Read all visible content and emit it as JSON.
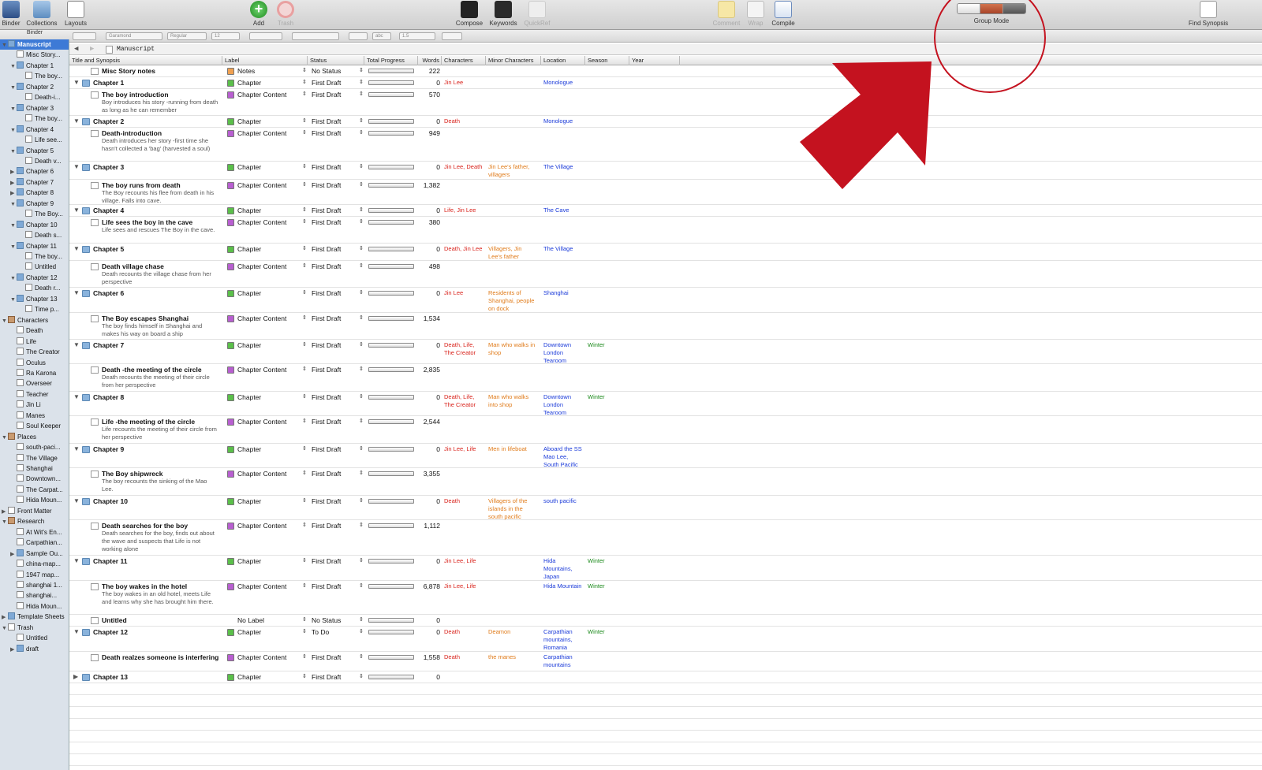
{
  "toolbar": {
    "binder": "Binder",
    "collections": "Collections",
    "layouts": "Layouts",
    "add": "Add",
    "trash": "Trash",
    "compose": "Compose",
    "keywords": "Keywords",
    "quickref": "QuickRef",
    "comment": "Comment",
    "wrap": "Wrap",
    "compile": "Compile",
    "group_mode": "Group Mode",
    "find_synopsis": "Find Synopsis"
  },
  "formatbar": {
    "font": "Garamond",
    "style": "Regular",
    "size": "12",
    "spacing": "1.5",
    "text_color": "abc"
  },
  "binder": {
    "header": "Binder",
    "items": [
      {
        "label": "Manuscript",
        "depth": 0,
        "disc": "▼",
        "icon": "folder",
        "sel": true
      },
      {
        "label": "Misc Story...",
        "depth": 1,
        "disc": "",
        "icon": "doc"
      },
      {
        "label": "Chapter 1",
        "depth": 1,
        "disc": "▼",
        "icon": "folder"
      },
      {
        "label": "The boy...",
        "depth": 2,
        "disc": "",
        "icon": "doc"
      },
      {
        "label": "Chapter 2",
        "depth": 1,
        "disc": "▼",
        "icon": "folder"
      },
      {
        "label": "Death-i...",
        "depth": 2,
        "disc": "",
        "icon": "doc"
      },
      {
        "label": "Chapter 3",
        "depth": 1,
        "disc": "▼",
        "icon": "folder"
      },
      {
        "label": "The boy...",
        "depth": 2,
        "disc": "",
        "icon": "doc"
      },
      {
        "label": "Chapter 4",
        "depth": 1,
        "disc": "▼",
        "icon": "folder"
      },
      {
        "label": "Life see...",
        "depth": 2,
        "disc": "",
        "icon": "doc"
      },
      {
        "label": "Chapter 5",
        "depth": 1,
        "disc": "▼",
        "icon": "folder"
      },
      {
        "label": "Death v...",
        "depth": 2,
        "disc": "",
        "icon": "doc"
      },
      {
        "label": "Chapter 6",
        "depth": 1,
        "disc": "▶",
        "icon": "folder"
      },
      {
        "label": "Chapter 7",
        "depth": 1,
        "disc": "▶",
        "icon": "folder"
      },
      {
        "label": "Chapter 8",
        "depth": 1,
        "disc": "▶",
        "icon": "folder"
      },
      {
        "label": "Chapter 9",
        "depth": 1,
        "disc": "▼",
        "icon": "folder"
      },
      {
        "label": "The Boy...",
        "depth": 2,
        "disc": "",
        "icon": "doc"
      },
      {
        "label": "Chapter 10",
        "depth": 1,
        "disc": "▼",
        "icon": "folder"
      },
      {
        "label": "Death s...",
        "depth": 2,
        "disc": "",
        "icon": "doc"
      },
      {
        "label": "Chapter 11",
        "depth": 1,
        "disc": "▼",
        "icon": "folder"
      },
      {
        "label": "The boy...",
        "depth": 2,
        "disc": "",
        "icon": "doc"
      },
      {
        "label": "Untitled",
        "depth": 2,
        "disc": "",
        "icon": "doc"
      },
      {
        "label": "Chapter 12",
        "depth": 1,
        "disc": "▼",
        "icon": "folder"
      },
      {
        "label": "Death r...",
        "depth": 2,
        "disc": "",
        "icon": "doc"
      },
      {
        "label": "Chapter 13",
        "depth": 1,
        "disc": "▼",
        "icon": "folder"
      },
      {
        "label": "Time p...",
        "depth": 2,
        "disc": "",
        "icon": "doc"
      },
      {
        "label": "Characters",
        "depth": 0,
        "disc": "▼",
        "icon": "group"
      },
      {
        "label": "Death",
        "depth": 1,
        "disc": "",
        "icon": "doc"
      },
      {
        "label": "Life",
        "depth": 1,
        "disc": "",
        "icon": "doc"
      },
      {
        "label": "The Creator",
        "depth": 1,
        "disc": "",
        "icon": "doc"
      },
      {
        "label": "Oculus",
        "depth": 1,
        "disc": "",
        "icon": "doc"
      },
      {
        "label": "Ra Karona",
        "depth": 1,
        "disc": "",
        "icon": "doc"
      },
      {
        "label": "Overseer",
        "depth": 1,
        "disc": "",
        "icon": "doc"
      },
      {
        "label": "Teacher",
        "depth": 1,
        "disc": "",
        "icon": "doc"
      },
      {
        "label": "Jin Li",
        "depth": 1,
        "disc": "",
        "icon": "doc"
      },
      {
        "label": "Manes",
        "depth": 1,
        "disc": "",
        "icon": "doc"
      },
      {
        "label": "Soul Keeper",
        "depth": 1,
        "disc": "",
        "icon": "doc"
      },
      {
        "label": "Places",
        "depth": 0,
        "disc": "▼",
        "icon": "group"
      },
      {
        "label": "south-paci...",
        "depth": 1,
        "disc": "",
        "icon": "doc"
      },
      {
        "label": "The Village",
        "depth": 1,
        "disc": "",
        "icon": "doc"
      },
      {
        "label": "Shanghai",
        "depth": 1,
        "disc": "",
        "icon": "doc"
      },
      {
        "label": "Downtown...",
        "depth": 1,
        "disc": "",
        "icon": "doc"
      },
      {
        "label": "The Carpat...",
        "depth": 1,
        "disc": "",
        "icon": "doc"
      },
      {
        "label": "Hida Moun...",
        "depth": 1,
        "disc": "",
        "icon": "doc"
      },
      {
        "label": "Front Matter",
        "depth": 0,
        "disc": "▶",
        "icon": "doc"
      },
      {
        "label": "Research",
        "depth": 0,
        "disc": "▼",
        "icon": "group"
      },
      {
        "label": "At Wit's En...",
        "depth": 1,
        "disc": "",
        "icon": "doc"
      },
      {
        "label": "Carpathian...",
        "depth": 1,
        "disc": "",
        "icon": "doc"
      },
      {
        "label": "Sample Ou...",
        "depth": 1,
        "disc": "▶",
        "icon": "folder"
      },
      {
        "label": "china-map...",
        "depth": 1,
        "disc": "",
        "icon": "doc"
      },
      {
        "label": "1947 map...",
        "depth": 1,
        "disc": "",
        "icon": "doc"
      },
      {
        "label": "shanghai 1...",
        "depth": 1,
        "disc": "",
        "icon": "doc"
      },
      {
        "label": "shanghai...",
        "depth": 1,
        "disc": "",
        "icon": "doc"
      },
      {
        "label": "Hida Moun...",
        "depth": 1,
        "disc": "",
        "icon": "doc"
      },
      {
        "label": "Template Sheets",
        "depth": 0,
        "disc": "▶",
        "icon": "folder"
      },
      {
        "label": "Trash",
        "depth": 0,
        "disc": "▼",
        "icon": "doc"
      },
      {
        "label": "Untitled",
        "depth": 1,
        "disc": "",
        "icon": "doc"
      },
      {
        "label": "draft",
        "depth": 1,
        "disc": "▶",
        "icon": "folder"
      }
    ]
  },
  "crumb": {
    "label": "Manuscript"
  },
  "columns": {
    "title": "Title and Synopsis",
    "label": "Label",
    "status": "Status",
    "progress": "Total Progress",
    "words": "Words",
    "characters": "Characters",
    "minor": "Minor Characters",
    "location": "Location",
    "season": "Season",
    "year": "Year"
  },
  "colors": {
    "notes": "#f0a050",
    "chapter": "#5bbf4a",
    "content": "#b85fd0",
    "none": "#ffffff",
    "selection": "#3d7ad6",
    "annotation": "#c4121f"
  },
  "rows": [
    {
      "kind": "doc",
      "disc": "",
      "title": "Misc Story notes",
      "syn": "",
      "label": "Notes",
      "lc": "notes",
      "status": "No Status",
      "words": "222",
      "chars": "",
      "minor": "",
      "loc": "",
      "season": "",
      "h": 15
    },
    {
      "kind": "folder",
      "disc": "▼",
      "title": "Chapter 1",
      "syn": "",
      "label": "Chapter",
      "lc": "chapter",
      "status": "First Draft",
      "words": "0",
      "chars": "Jin Lee",
      "minor": "",
      "loc": "Monologue",
      "season": "",
      "h": 15
    },
    {
      "kind": "doc",
      "disc": "",
      "title": "The boy introduction",
      "syn": "Boy introduces his story -running from death as long as he can remember",
      "label": "Chapter Content",
      "lc": "content",
      "status": "First Draft",
      "words": "570",
      "chars": "",
      "minor": "",
      "loc": "",
      "season": "",
      "h": 34
    },
    {
      "kind": "folder",
      "disc": "▼",
      "title": "Chapter 2",
      "syn": "",
      "label": "Chapter",
      "lc": "chapter",
      "status": "First Draft",
      "words": "0",
      "chars": "Death",
      "minor": "",
      "loc": "Monologue",
      "season": "",
      "h": 15
    },
    {
      "kind": "doc",
      "disc": "",
      "title": "Death-introduction",
      "syn": "Death introduces her story -first time she hasn't collected a 'bag' (harvested a soul)",
      "label": "Chapter Content",
      "lc": "content",
      "status": "First Draft",
      "words": "949",
      "chars": "",
      "minor": "",
      "loc": "",
      "season": "",
      "h": 43
    },
    {
      "kind": "folder",
      "disc": "▼",
      "title": "Chapter 3",
      "syn": "",
      "label": "Chapter",
      "lc": "chapter",
      "status": "First Draft",
      "words": "0",
      "chars": "Jin Lee, Death",
      "minor": "Jin Lee's father, villagers",
      "loc": "The Village",
      "season": "",
      "h": 23
    },
    {
      "kind": "doc",
      "disc": "",
      "title": "The boy runs from death",
      "syn": "The Boy recounts his flee from death in his village.  Falls into cave.",
      "label": "Chapter Content",
      "lc": "content",
      "status": "First Draft",
      "words": "1,382",
      "chars": "",
      "minor": "",
      "loc": "",
      "season": "",
      "h": 32
    },
    {
      "kind": "folder",
      "disc": "▼",
      "title": "Chapter 4",
      "syn": "",
      "label": "Chapter",
      "lc": "chapter",
      "status": "First Draft",
      "words": "0",
      "chars": "Life, Jin Lee",
      "minor": "",
      "loc": "The Cave",
      "season": "",
      "h": 15
    },
    {
      "kind": "doc",
      "disc": "",
      "title": "Life sees the boy in the cave",
      "syn": "Life sees and rescues The Boy in the cave.",
      "label": "Chapter Content",
      "lc": "content",
      "status": "First Draft",
      "words": "380",
      "chars": "",
      "minor": "",
      "loc": "",
      "season": "",
      "h": 34
    },
    {
      "kind": "folder",
      "disc": "▼",
      "title": "Chapter 5",
      "syn": "",
      "label": "Chapter",
      "lc": "chapter",
      "status": "First Draft",
      "words": "0",
      "chars": "Death, Jin Lee",
      "minor": "Villagers, Jin Lee's father",
      "loc": "The Village",
      "season": "",
      "h": 22
    },
    {
      "kind": "doc",
      "disc": "",
      "title": "Death village chase",
      "syn": "Death recounts the village chase from her perspective",
      "label": "Chapter Content",
      "lc": "content",
      "status": "First Draft",
      "words": "498",
      "chars": "",
      "minor": "",
      "loc": "",
      "season": "",
      "h": 34
    },
    {
      "kind": "folder",
      "disc": "▼",
      "title": "Chapter 6",
      "syn": "",
      "label": "Chapter",
      "lc": "chapter",
      "status": "First Draft",
      "words": "0",
      "chars": "Jin Lee",
      "minor": "Residents of Shanghai, people on dock",
      "loc": "Shanghai",
      "season": "",
      "h": 32
    },
    {
      "kind": "doc",
      "disc": "",
      "title": "The Boy escapes Shanghai",
      "syn": "The boy finds himself in Shanghai and makes his way on board a ship",
      "label": "Chapter Content",
      "lc": "content",
      "status": "First Draft",
      "words": "1,534",
      "chars": "",
      "minor": "",
      "loc": "",
      "season": "",
      "h": 34
    },
    {
      "kind": "folder",
      "disc": "▼",
      "title": "Chapter 7",
      "syn": "",
      "label": "Chapter",
      "lc": "chapter",
      "status": "First Draft",
      "words": "0",
      "chars": "Death, Life, The Creator",
      "minor": "Man who walks in shop",
      "loc": "Downtown London Tearoom",
      "season": "Winter",
      "h": 31
    },
    {
      "kind": "doc",
      "disc": "",
      "title": "Death -the meeting of the circle",
      "syn": "Death recounts the meeting of their circle from her perspective",
      "label": "Chapter Content",
      "lc": "content",
      "status": "First Draft",
      "words": "2,835",
      "chars": "",
      "minor": "",
      "loc": "",
      "season": "",
      "h": 35
    },
    {
      "kind": "folder",
      "disc": "▼",
      "title": "Chapter 8",
      "syn": "",
      "label": "Chapter",
      "lc": "chapter",
      "status": "First Draft",
      "words": "0",
      "chars": "Death, Life, The Creator",
      "minor": "Man who walks into shop",
      "loc": "Downtown London Tearoom",
      "season": "Winter",
      "h": 31
    },
    {
      "kind": "doc",
      "disc": "",
      "title": "Life -the meeting of the circle",
      "syn": "Life recounts the meeting of their circle from her perspective",
      "label": "Chapter Content",
      "lc": "content",
      "status": "First Draft",
      "words": "2,544",
      "chars": "",
      "minor": "",
      "loc": "",
      "season": "",
      "h": 35
    },
    {
      "kind": "folder",
      "disc": "▼",
      "title": "Chapter 9",
      "syn": "",
      "label": "Chapter",
      "lc": "chapter",
      "status": "First Draft",
      "words": "0",
      "chars": "Jin Lee, Life",
      "minor": "Men in lifeboat",
      "loc": "Aboard the SS Mao Lee, South Pacific",
      "season": "",
      "h": 31
    },
    {
      "kind": "doc",
      "disc": "",
      "title": "The Boy shipwreck",
      "syn": "The boy recounts the sinking of the Mao Lee.",
      "label": "Chapter Content",
      "lc": "content",
      "status": "First Draft",
      "words": "3,355",
      "chars": "",
      "minor": "",
      "loc": "",
      "season": "",
      "h": 35
    },
    {
      "kind": "folder",
      "disc": "▼",
      "title": "Chapter 10",
      "syn": "",
      "label": "Chapter",
      "lc": "chapter",
      "status": "First Draft",
      "words": "0",
      "chars": "Death",
      "minor": "Villagers of the islands in the south pacific",
      "loc": "south pacific",
      "season": "",
      "h": 31
    },
    {
      "kind": "doc",
      "disc": "",
      "title": "Death searches for the boy",
      "syn": "Death searches for the boy, finds out about the wave and suspects that Life is not working alone",
      "label": "Chapter Content",
      "lc": "content",
      "status": "First Draft",
      "words": "1,112",
      "chars": "",
      "minor": "",
      "loc": "",
      "season": "",
      "h": 45
    },
    {
      "kind": "folder",
      "disc": "▼",
      "title": "Chapter 11",
      "syn": "",
      "label": "Chapter",
      "lc": "chapter",
      "status": "First Draft",
      "words": "0",
      "chars": "Jin Lee, Life",
      "minor": "",
      "loc": "Hida Mountains, Japan",
      "season": "Winter",
      "h": 32
    },
    {
      "kind": "doc",
      "disc": "",
      "title": "The boy wakes in the hotel",
      "syn": "The boy wakes in an old hotel, meets Life and learns why she has brought him there.",
      "label": "Chapter Content",
      "lc": "content",
      "status": "First Draft",
      "words": "6,878",
      "chars": "Jin Lee, Life",
      "minor": "",
      "loc": "Hida Mountain",
      "season": "Winter",
      "h": 43
    },
    {
      "kind": "doc",
      "disc": "",
      "title": "Untitled",
      "syn": "",
      "label": "No Label",
      "lc": "none",
      "status": "No Status",
      "words": "0",
      "chars": "",
      "minor": "",
      "loc": "",
      "season": "",
      "h": 15
    },
    {
      "kind": "folder",
      "disc": "▼",
      "title": "Chapter 12",
      "syn": "",
      "label": "Chapter",
      "lc": "chapter",
      "status": "To Do",
      "words": "0",
      "chars": "Death",
      "minor": "Deamon",
      "loc": "Carpathian mountains, Romania",
      "season": "Winter",
      "h": 32
    },
    {
      "kind": "doc",
      "disc": "",
      "title": "Death realzes someone is interfering",
      "syn": "",
      "label": "Chapter Content",
      "lc": "content",
      "status": "First Draft",
      "words": "1,558",
      "chars": "Death",
      "minor": "the manes",
      "loc": "Carpathian mountains",
      "season": "",
      "h": 25
    },
    {
      "kind": "folder",
      "disc": "▶",
      "title": "Chapter 13",
      "syn": "",
      "label": "Chapter",
      "lc": "chapter",
      "status": "First Draft",
      "words": "0",
      "chars": "",
      "minor": "",
      "loc": "",
      "season": "",
      "h": 15
    }
  ]
}
